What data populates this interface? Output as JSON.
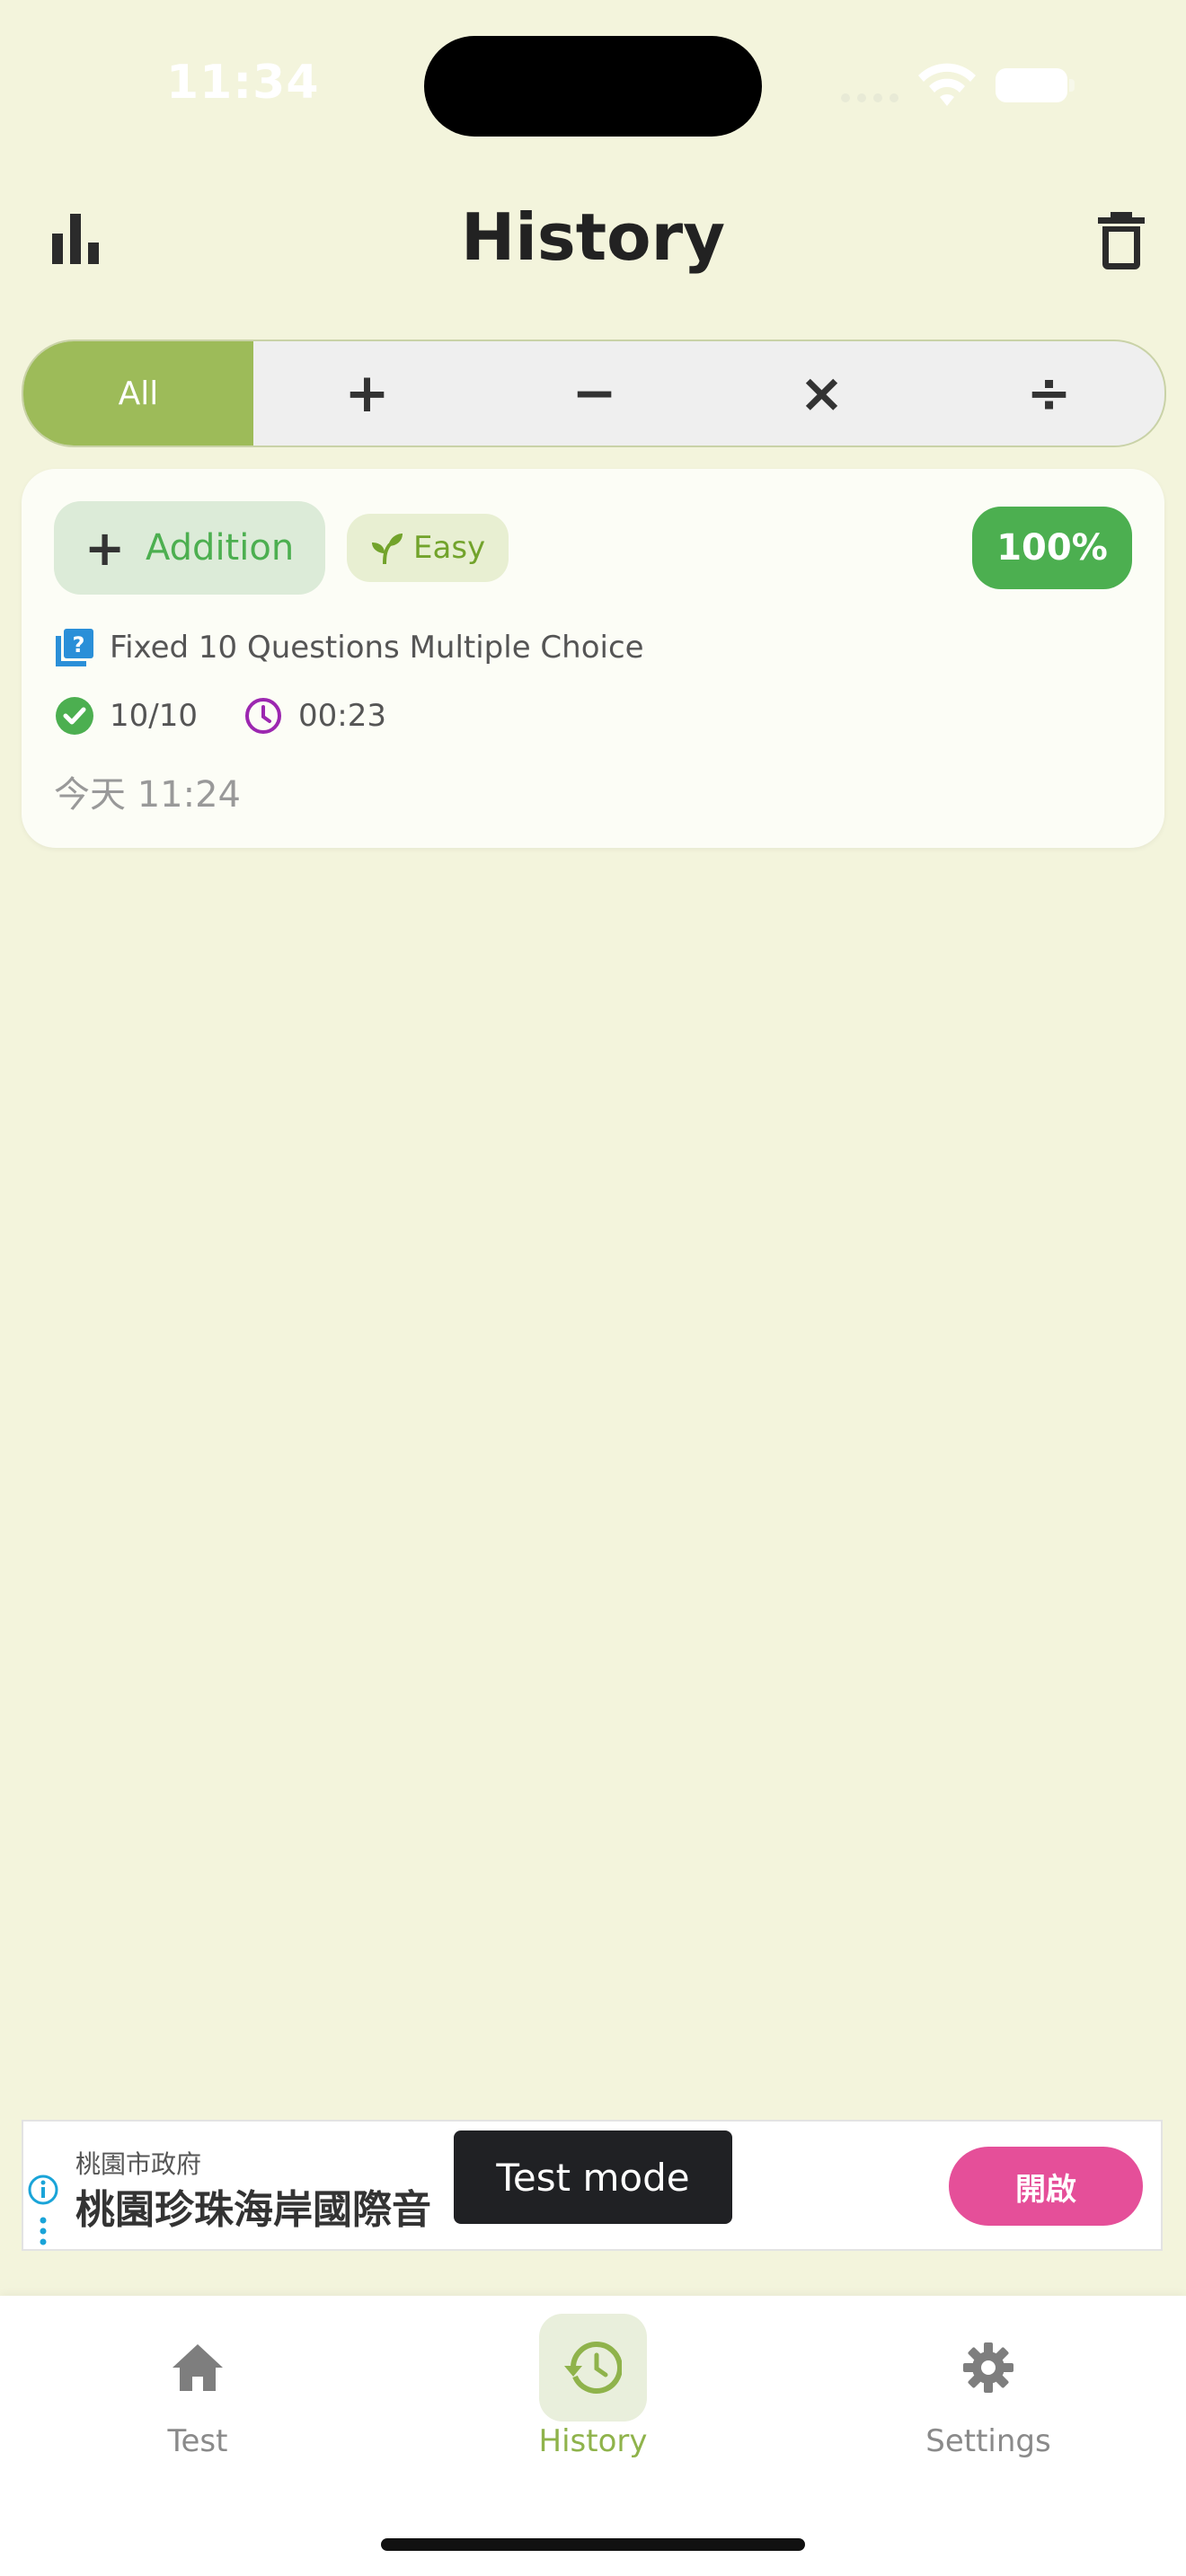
{
  "status_bar": {
    "time": "11:34"
  },
  "header": {
    "title": "History",
    "stats_icon": "bar-chart-icon",
    "delete_icon": "trash-icon"
  },
  "filters": {
    "all_label": "All",
    "ops": [
      "+",
      "−",
      "×",
      "÷"
    ],
    "selected": "All",
    "accent": "#9dbb59"
  },
  "history": [
    {
      "operation_symbol": "+",
      "operation": "Addition",
      "difficulty": "Easy",
      "score_percent": "100%",
      "mode": "Fixed 10 Questions Multiple Choice",
      "correct": "10/10",
      "duration": "00:23",
      "date": "今天 11:24"
    }
  ],
  "ad": {
    "sponsor": "桃園市政府",
    "headline": "桃園珍珠海岸國際音",
    "cta": "開啟",
    "toast": "Test mode"
  },
  "tabs": [
    {
      "label": "Test",
      "icon": "home-icon"
    },
    {
      "label": "History",
      "icon": "history-icon",
      "active": true
    },
    {
      "label": "Settings",
      "icon": "gear-icon"
    }
  ],
  "colors": {
    "background": "#f3f4dc",
    "success": "#4caf50",
    "ad_cta": "#e54f99"
  }
}
